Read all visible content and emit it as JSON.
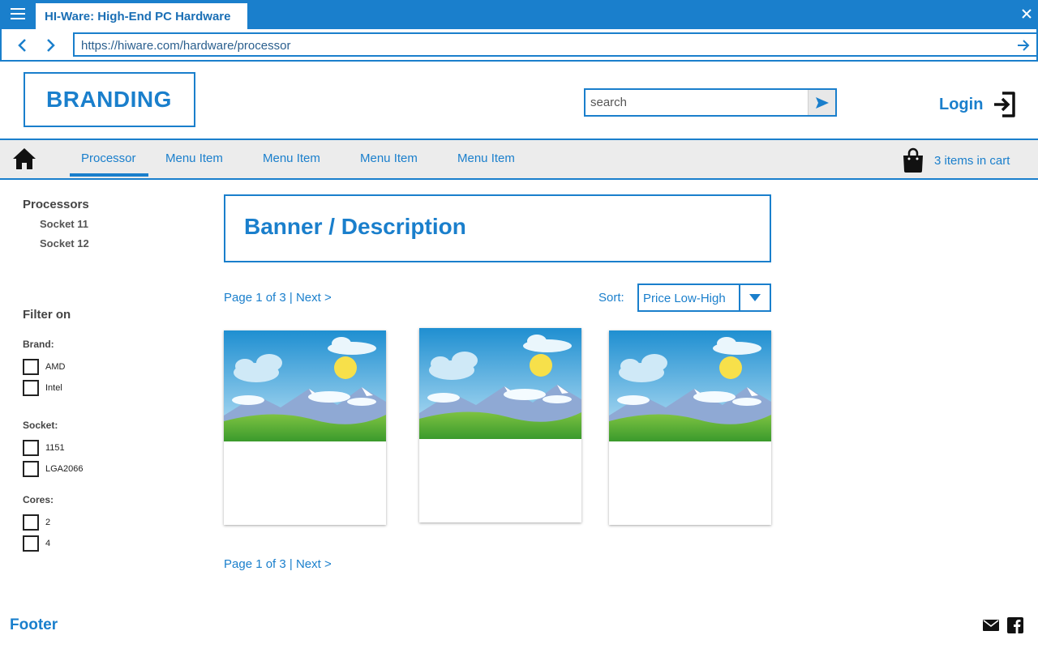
{
  "browser": {
    "tab_title": "HI-Ware: High-End PC Hardware",
    "url": "https://hiware.com/hardware/processor"
  },
  "header": {
    "brand": "BRANDING",
    "search_placeholder": "search",
    "login_label": "Login"
  },
  "nav": {
    "items": [
      "Processor",
      "Menu Item",
      "Menu Item",
      "Menu Item",
      "Menu Item"
    ],
    "active": "Processor",
    "cart_label": "3 items in cart"
  },
  "sidebar": {
    "category_title": "Processors",
    "subcategories": [
      "Socket 11",
      "Socket 12"
    ],
    "filter_title": "Filter on",
    "filters": [
      {
        "label": "Brand:",
        "options": [
          "AMD",
          "Intel"
        ]
      },
      {
        "label": "Socket:",
        "options": [
          "1151",
          "LGA2066"
        ]
      },
      {
        "label": "Cores:",
        "options": [
          "2",
          "4"
        ]
      }
    ]
  },
  "main": {
    "banner": "Banner / Description",
    "pager_top": "Page 1 of 3 | Next >",
    "pager_bottom": "Page 1 of 3 | Next >",
    "sort_label": "Sort:",
    "sort_value": "Price Low-High"
  },
  "footer": {
    "label": "Footer",
    "icons": [
      "mail-icon",
      "facebook-icon"
    ]
  },
  "colors": {
    "accent": "#1a7fcc",
    "nav_background": "#ececec"
  }
}
